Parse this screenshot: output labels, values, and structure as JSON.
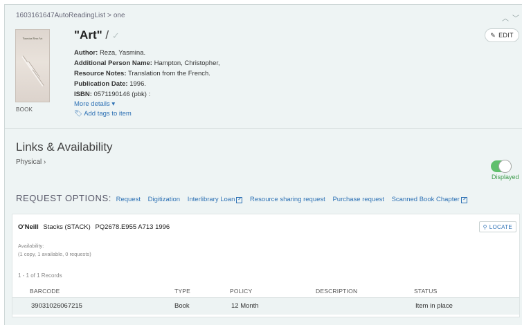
{
  "breadcrumb": {
    "list": "1603161647AutoReadingList",
    "separator": ">",
    "section": "one"
  },
  "item": {
    "type_label": "BOOK",
    "title": "\"Art\"",
    "title_slash": "/",
    "author_label": "Author:",
    "author": "Reza, Yasmina.",
    "person_label": "Additional Person Name:",
    "person": "Hampton, Christopher,",
    "notes_label": "Resource Notes:",
    "notes": "Translation from the French.",
    "pubdate_label": "Publication Date:",
    "pubdate": "1996.",
    "isbn_label": "ISBN:",
    "isbn": "0571190146 (pbk) :",
    "more_details": "More details",
    "add_tags": "Add tags to item",
    "edit_label": "EDIT",
    "cover_text": "Yasmina Reza Art"
  },
  "availability": {
    "heading": "Links & Availability",
    "physical": "Physical",
    "displayed": "Displayed",
    "request_label": "REQUEST OPTIONS:",
    "options": [
      "Request",
      "Digitization",
      "Interlibrary Loan",
      "Resource sharing request",
      "Purchase request",
      "Scanned Book Chapter"
    ]
  },
  "holding": {
    "location": "O'Neill",
    "location_detail": "Stacks (STACK)",
    "call_number": "PQ2678.E955 A713 1996",
    "locate_label": "LOCATE",
    "availability_label": "Availability:",
    "availability_summary": "(1 copy, 1 available, 0 requests)",
    "records": "1 - 1 of 1 Records",
    "columns": [
      "BARCODE",
      "TYPE",
      "POLICY",
      "DESCRIPTION",
      "STATUS"
    ],
    "rows": [
      {
        "barcode": "39031026067215",
        "type": "Book",
        "policy": "12 Month",
        "description": "",
        "status": "Item in place"
      }
    ]
  },
  "colors": {
    "link": "#2f72b5",
    "toggle_on": "#5fbf6c",
    "panel_bg": "#eef4f4"
  },
  "icons": [
    "chevron-up-icon",
    "chevron-down-icon",
    "pencil-icon",
    "tag-icon",
    "caret-down-icon",
    "external-link-icon",
    "map-marker-icon"
  ]
}
